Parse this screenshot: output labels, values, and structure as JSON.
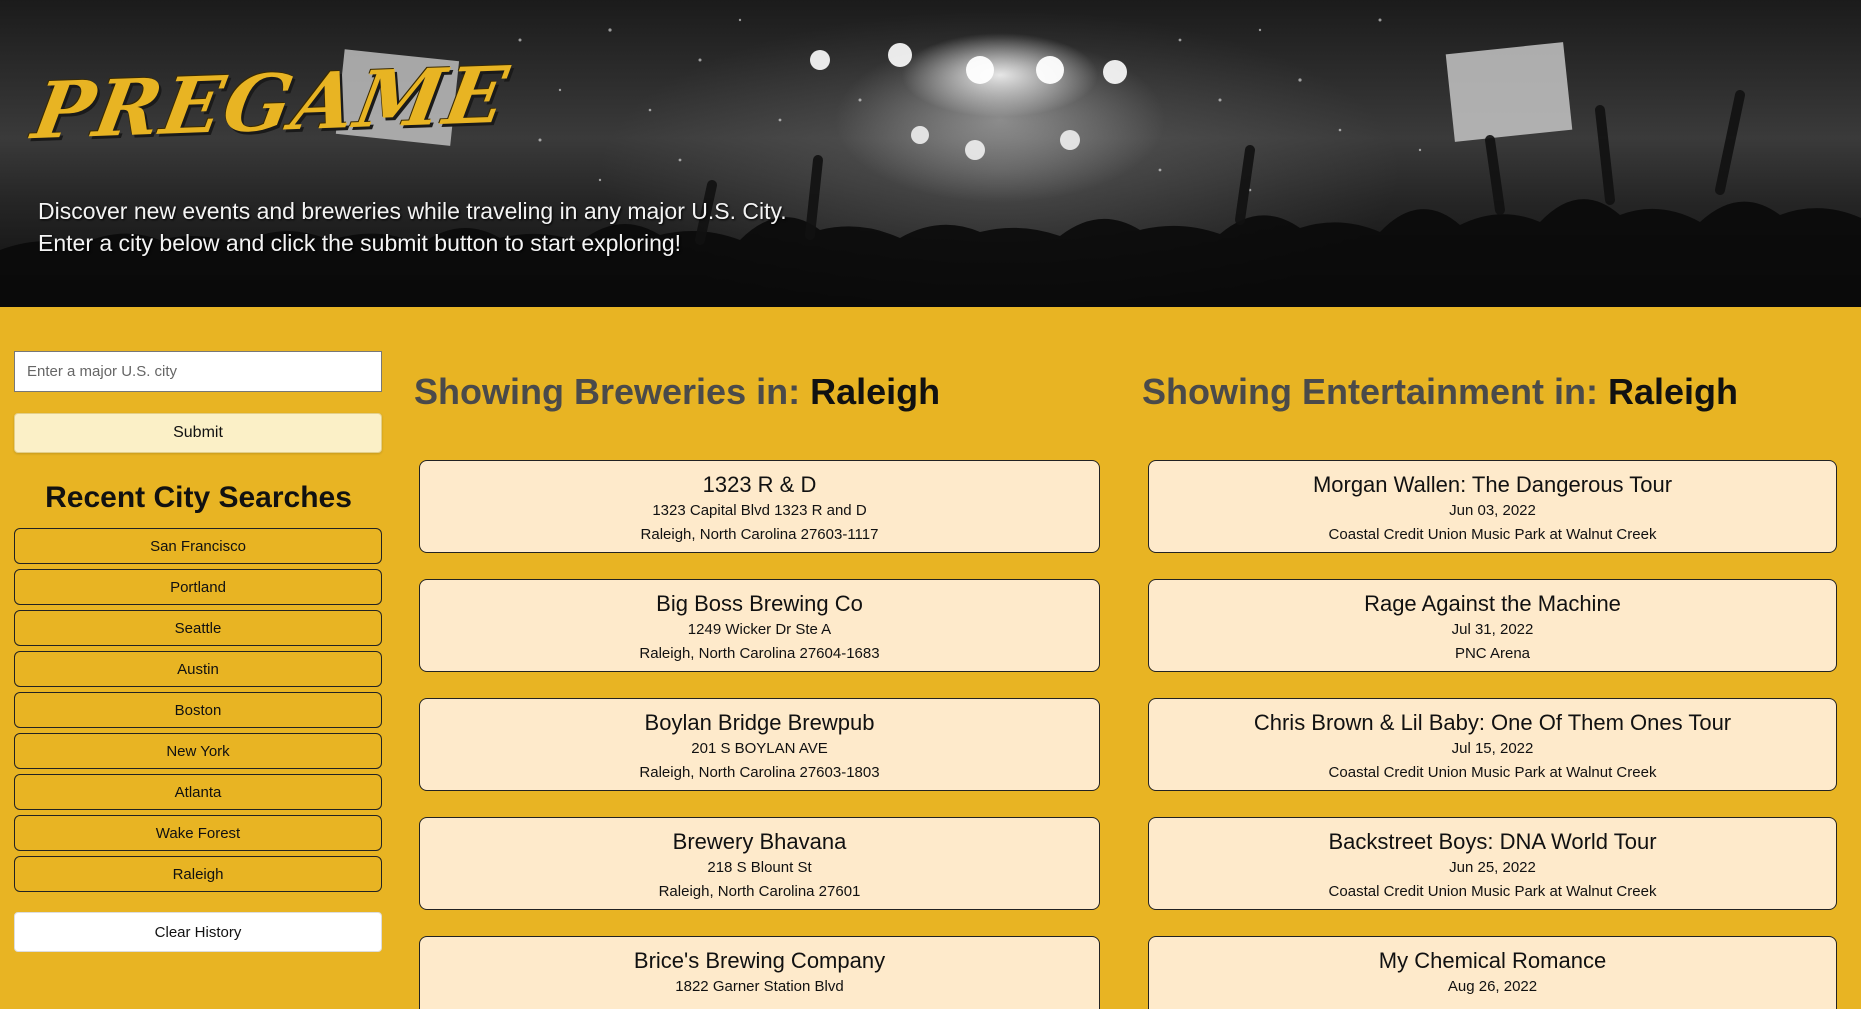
{
  "header": {
    "logo": "PREGAME",
    "tagline_line1": "Discover new events and breweries while traveling in any major U.S. City.",
    "tagline_line2": "Enter a city below and click the submit button to start exploring!"
  },
  "search": {
    "placeholder": "Enter a major U.S. city",
    "value": "",
    "submit_label": "Submit"
  },
  "recent": {
    "title": "Recent City Searches",
    "cities": [
      "San Francisco",
      "Portland",
      "Seattle",
      "Austin",
      "Boston",
      "New York",
      "Atlanta",
      "Wake Forest",
      "Raleigh"
    ],
    "clear_label": "Clear History"
  },
  "breweries": {
    "heading_prefix": "Showing Breweries in: ",
    "city": "Raleigh",
    "items": [
      {
        "name": "1323 R & D",
        "street": "1323 Capital Blvd 1323 R and D",
        "locality": "Raleigh, North Carolina 27603-1117"
      },
      {
        "name": "Big Boss Brewing Co",
        "street": "1249 Wicker Dr Ste A",
        "locality": "Raleigh, North Carolina 27604-1683"
      },
      {
        "name": "Boylan Bridge Brewpub",
        "street": "201 S BOYLAN AVE",
        "locality": "Raleigh, North Carolina 27603-1803"
      },
      {
        "name": "Brewery Bhavana",
        "street": "218 S Blount St",
        "locality": "Raleigh, North Carolina 27601"
      },
      {
        "name": "Brice's Brewing Company",
        "street": "1822 Garner Station Blvd",
        "locality": ""
      }
    ]
  },
  "events": {
    "heading_prefix": "Showing Entertainment in: ",
    "city": "Raleigh",
    "items": [
      {
        "name": "Morgan Wallen: The Dangerous Tour",
        "date": "Jun 03, 2022",
        "venue": "Coastal Credit Union Music Park at Walnut Creek"
      },
      {
        "name": "Rage Against the Machine",
        "date": "Jul 31, 2022",
        "venue": "PNC Arena"
      },
      {
        "name": "Chris Brown & Lil Baby: One Of Them Ones Tour",
        "date": "Jul 15, 2022",
        "venue": "Coastal Credit Union Music Park at Walnut Creek"
      },
      {
        "name": "Backstreet Boys: DNA World Tour",
        "date": "Jun 25, 2022",
        "venue": "Coastal Credit Union Music Park at Walnut Creek"
      },
      {
        "name": "My Chemical Romance",
        "date": "Aug 26, 2022",
        "venue": ""
      }
    ]
  }
}
